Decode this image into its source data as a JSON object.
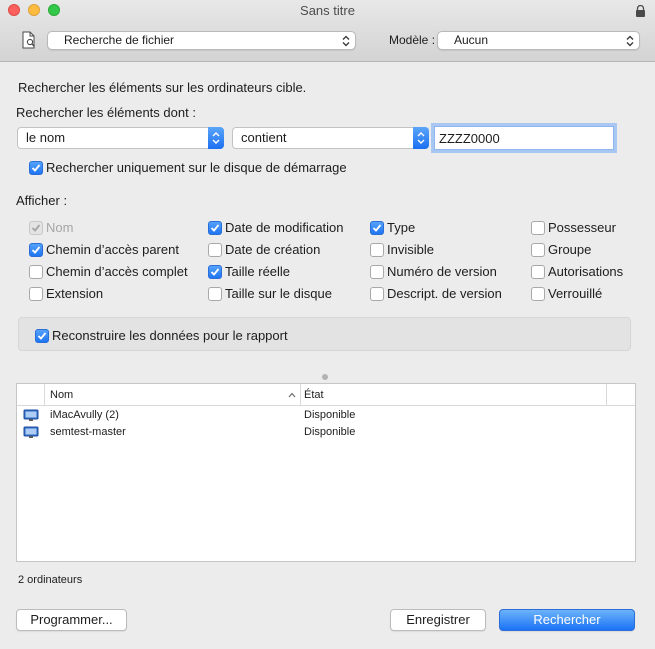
{
  "window": {
    "title": "Sans titre"
  },
  "toolbar": {
    "search_type": "Recherche de fichier",
    "model_label": "Modèle :",
    "model_value": "Aucun"
  },
  "intro": "Rechercher les éléments sur les ordinateurs cible.",
  "criteria": {
    "label": "Rechercher les éléments dont :",
    "field": "le nom",
    "operator": "contient",
    "value": "ZZZZ0000",
    "startup_only": "Rechercher uniquement sur le disque de démarrage"
  },
  "display": {
    "label": "Afficher :",
    "options": {
      "name": "Nom",
      "modified": "Date de modification",
      "type": "Type",
      "owner": "Possesseur",
      "parent_path": "Chemin d’accès parent",
      "created": "Date de création",
      "invisible": "Invisible",
      "group": "Groupe",
      "full_path": "Chemin d’accès complet",
      "real_size": "Taille réelle",
      "version_number": "Numéro de version",
      "permissions": "Autorisations",
      "extension": "Extension",
      "disk_size": "Taille sur le disque",
      "version_desc": "Descript. de version",
      "locked": "Verrouillé"
    }
  },
  "rebuild": "Reconstruire les données pour le rapport",
  "table": {
    "columns": {
      "name": "Nom",
      "state": "État"
    },
    "rows": [
      {
        "name": "iMacAvully (2)",
        "state": "Disponible"
      },
      {
        "name": "semtest-master",
        "state": "Disponible"
      }
    ]
  },
  "count": "2 ordinateurs",
  "buttons": {
    "schedule": "Programmer...",
    "save": "Enregistrer",
    "search": "Rechercher"
  }
}
